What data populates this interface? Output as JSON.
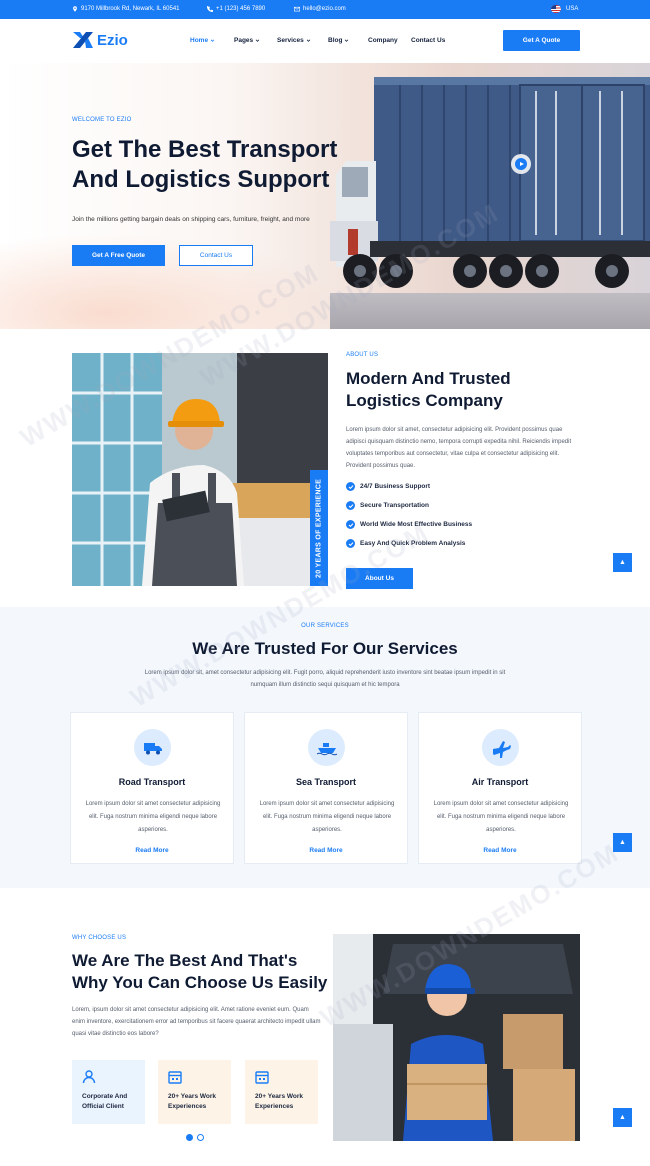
{
  "topbar": {
    "address": "9170 Millbrook Rd, Newark, IL 60541",
    "phone": "+1 (123) 456 7890",
    "email": "hello@ezio.com",
    "language": "USA"
  },
  "brand": {
    "name": "Ezio",
    "color": "#1a7cf5"
  },
  "nav": {
    "items": [
      {
        "label": "Home",
        "has_dropdown": true,
        "active": true
      },
      {
        "label": "Pages",
        "has_dropdown": true
      },
      {
        "label": "Services",
        "has_dropdown": true
      },
      {
        "label": "Blog",
        "has_dropdown": true
      },
      {
        "label": "Company",
        "has_dropdown": false
      },
      {
        "label": "Contact Us",
        "has_dropdown": false
      }
    ],
    "cta": "Get A Quote"
  },
  "hero": {
    "eyebrow": "WELCOME TO EZIO",
    "title_line1": "Get The Best Transport",
    "title_line2": "And Logistics Support",
    "lead": "Join the millions getting bargain deals on shipping cars, furniture, freight, and more",
    "primary_button": "Get A Free Quote",
    "secondary_button": "Contact Us"
  },
  "about": {
    "eyebrow": "ABOUT US",
    "title_line1": "Modern And Trusted",
    "title_line2": "Logistics Company",
    "paragraph": "Lorem ipsum dolor sit amet, consectetur adipisicing elit. Provident possimus quae adipisci quisquam distinctio nemo, tempora corrupti expedita nihil. Reiciendis impedit voluptates temporibus aut consectetur, vitae culpa et consectetur adipisicing elit. Provident possimus quae.",
    "experience_badge": "20 YEARS OF EXPERIENCE",
    "checklist": [
      "24/7 Business Support",
      "Secure Transportation",
      "World Wide Most Effective Business",
      "Easy And Quick Problem Analysis"
    ],
    "button": "About Us"
  },
  "services": {
    "eyebrow": "OUR SERVICES",
    "title": "We Are Trusted For Our Services",
    "paragraph": "Lorem ipsum dolor sit, amet consectetur adipisicing elit. Fugit porro, aliquid reprehenderit iusto inventore sint beatae ipsum impedit in sit numquam illum distinctio sequi quisquam et hic tempora",
    "cards": [
      {
        "icon": "truck-icon",
        "title": "Road Transport",
        "desc": "Lorem ipsum dolor sit amet consectetur adipisicing elit. Fuga nostrum minima eligendi neque labore asperiores.",
        "link": "Read More"
      },
      {
        "icon": "ship-icon",
        "title": "Sea Transport",
        "desc": "Lorem ipsum dolor sit amet consectetur adipisicing elit. Fuga nostrum minima eligendi neque labore asperiores.",
        "link": "Read More"
      },
      {
        "icon": "airplane-icon",
        "title": "Air Transport",
        "desc": "Lorem ipsum dolor sit amet consectetur adipisicing elit. Fuga nostrum minima eligendi neque labore asperiores.",
        "link": "Read More"
      }
    ]
  },
  "why": {
    "eyebrow": "WHY CHOOSE US",
    "title_line1": "We Are The Best And That's",
    "title_line2": "Why You Can Choose Us Easily",
    "paragraph": "Lorem, ipsum dolor sit amet consectetur adipisicing elit. Amet ratione eveniet eum. Quam enim inventore, exercitationem error ad temporibus sit facere quaerat architecto impedit ullam quasi vitae distinctio eos labore?",
    "features": [
      {
        "icon": "user-icon",
        "label": "Corporate And Official Client",
        "bg": "#eaf4fe"
      },
      {
        "icon": "calendar-icon",
        "label": "20+ Years Work Experiences",
        "bg": "#fdf4e7"
      },
      {
        "icon": "calendar-icon",
        "label": "20+ Years Work Experiences",
        "bg": "#fdf4e7"
      }
    ]
  },
  "watermark": "WWW.DOWNDEMO.COM"
}
